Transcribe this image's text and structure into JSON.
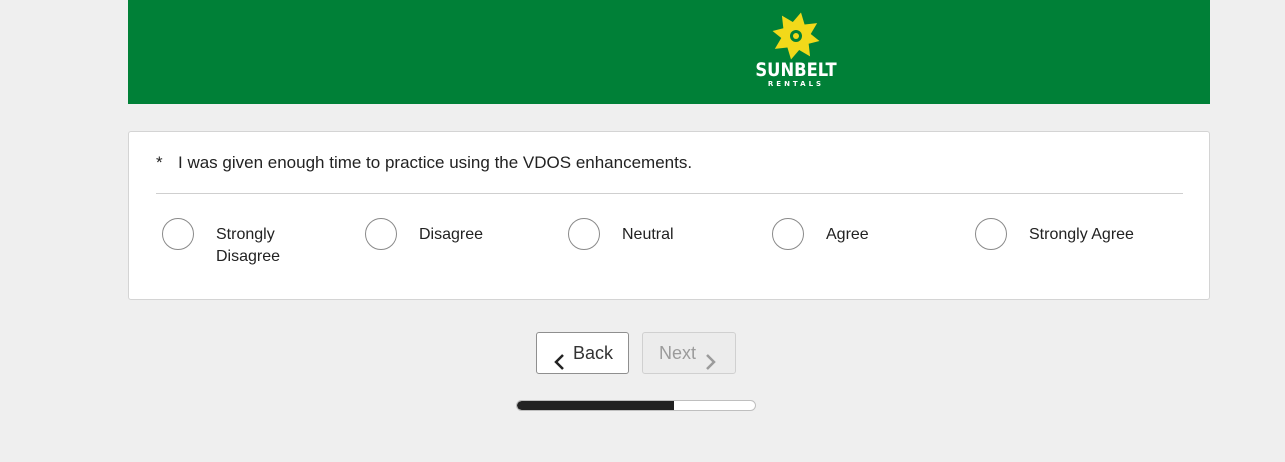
{
  "header": {
    "logo_word": "SUNBELT",
    "logo_sub": "RENTALS",
    "logo_icon": "sun-icon",
    "brand_green": "#008037",
    "brand_yellow": "#f2d91a"
  },
  "question": {
    "required_mark": "*",
    "text": "I was given enough time to practice using the VDOS enhancements.",
    "options": [
      {
        "label": "Strongly Disagree"
      },
      {
        "label": "Disagree"
      },
      {
        "label": "Neutral"
      },
      {
        "label": "Agree"
      },
      {
        "label": "Strongly Agree"
      }
    ]
  },
  "nav": {
    "back_label": "Back",
    "next_label": "Next",
    "back_icon": "chevron-left-icon",
    "next_icon": "chevron-right-icon"
  },
  "progress": {
    "fraction": 0.66
  }
}
